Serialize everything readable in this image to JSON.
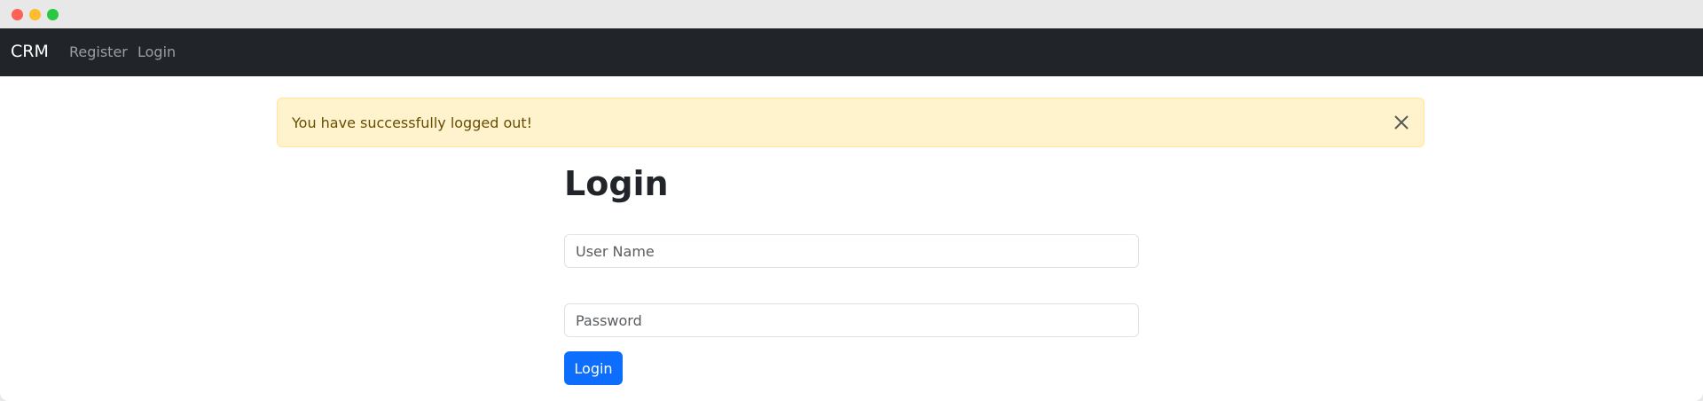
{
  "navbar": {
    "brand": "CRM",
    "links": [
      {
        "label": "Register"
      },
      {
        "label": "Login"
      }
    ]
  },
  "alert": {
    "message": "You have successfully logged out!",
    "type": "warning"
  },
  "page": {
    "title": "Login"
  },
  "form": {
    "username": {
      "placeholder": "User Name",
      "value": ""
    },
    "password": {
      "placeholder": "Password",
      "value": ""
    },
    "submit_label": "Login"
  },
  "colors": {
    "navbar_bg": "#212529",
    "alert_bg": "#fff3cd",
    "alert_text": "#664d03",
    "primary": "#0d6efd"
  },
  "icons": {
    "alert_close": "close-icon"
  }
}
